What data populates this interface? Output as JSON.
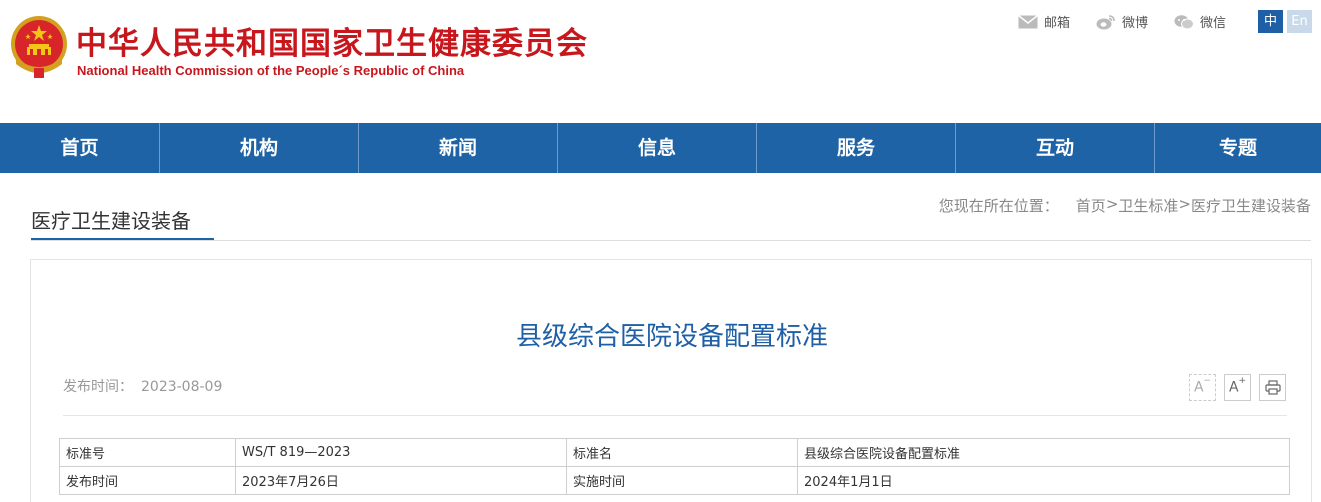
{
  "header": {
    "title_cn": "中华人民共和国国家卫生健康委员会",
    "title_en": "National Health Commission of the People´s Republic of China",
    "emblem_icon": "national-emblem-icon",
    "links": [
      {
        "label": "邮箱",
        "icon": "mail-icon"
      },
      {
        "label": "微博",
        "icon": "weibo-icon"
      },
      {
        "label": "微信",
        "icon": "wechat-icon"
      }
    ],
    "lang_zh": "中",
    "lang_en": "En",
    "brand_red": "#c8161d",
    "nav_blue": "#1e63a6"
  },
  "nav": [
    "首页",
    "机构",
    "新闻",
    "信息",
    "服务",
    "互动",
    "专题"
  ],
  "section": {
    "title": "医疗卫生建设装备",
    "location_label": "您现在所在位置：",
    "crumbs": [
      "首页",
      "卫生标准",
      "医疗卫生建设装备"
    ],
    "sep": ">"
  },
  "article": {
    "title": "县级综合医院设备配置标准",
    "pub_label": "发布时间：",
    "pub_date": "2023-08-09",
    "tools": {
      "font_smaller": "A",
      "font_larger": "A",
      "print_icon": "print-icon"
    }
  },
  "std_table": [
    [
      "标准号",
      "WS/T 819—2023",
      "标准名",
      "县级综合医院设备配置标准"
    ],
    [
      "发布时间",
      "2023年7月26日",
      "实施时间",
      "2024年1月1日"
    ]
  ]
}
